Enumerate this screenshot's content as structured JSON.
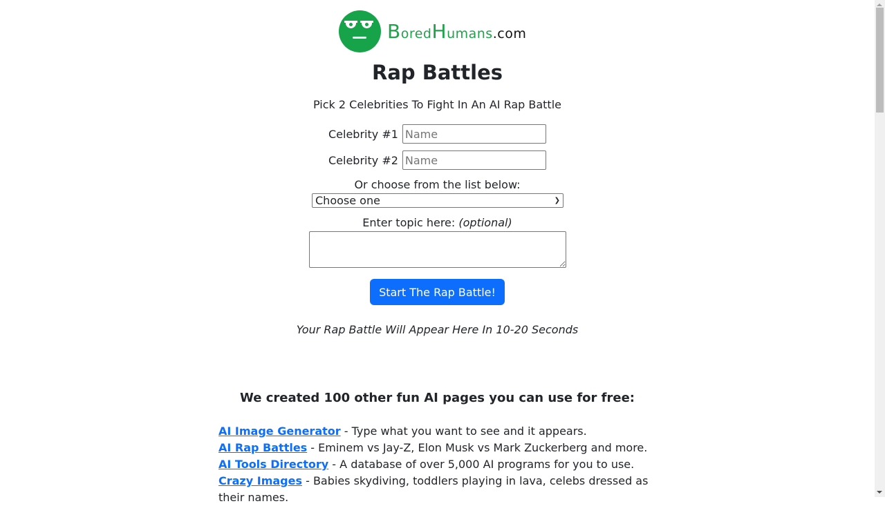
{
  "logo": {
    "alt": "BoredHumans.com",
    "b": "B",
    "ored": "ored",
    "h": "H",
    "umans": "umans",
    "com": ".com",
    "brand_color": "#16a34a"
  },
  "title": "Rap Battles",
  "subtitle": "Pick 2 Celebrities To Fight In An AI Rap Battle",
  "form": {
    "celebrity1_label": "Celebrity #1",
    "celebrity1_placeholder": "Name",
    "celebrity1_value": "",
    "celebrity2_label": "Celebrity #2",
    "celebrity2_placeholder": "Name",
    "celebrity2_value": "",
    "choose_label": "Or choose from the list below:",
    "select_value": "Choose one",
    "topic_label": "Enter topic here:",
    "topic_optional": "(optional)",
    "topic_value": "",
    "submit_label": "Start The Rap Battle!",
    "button_color": "#0d6efd"
  },
  "result_placeholder": "Your Rap Battle Will Appear Here In 10-20 Seconds",
  "more": {
    "heading": "We created 100 other fun AI pages you can use for free:",
    "items": [
      {
        "link": "AI Image Generator",
        "desc": " - Type what you want to see and it appears."
      },
      {
        "link": "AI Rap Battles",
        "desc": " - Eminem vs Jay-Z, Elon Musk vs Mark Zuckerberg and more."
      },
      {
        "link": "AI Tools Directory",
        "desc": " - A database of over 5,000 AI programs for you to use."
      },
      {
        "link": "Crazy Images",
        "desc": " - Babies skydiving, toddlers playing in lava, celebs dressed as their names."
      }
    ]
  }
}
